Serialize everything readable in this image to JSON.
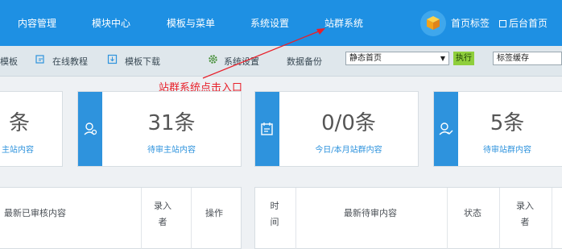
{
  "nav": {
    "items": [
      {
        "label": "内容管理"
      },
      {
        "label": "模块中心"
      },
      {
        "label": "模板与菜单"
      },
      {
        "label": "系统设置"
      },
      {
        "label": "站群系统"
      }
    ],
    "home_tag": "首页标签",
    "backstage": "后台首页"
  },
  "toolbar": {
    "template_partial": "模板",
    "online_tutorial": "在线教程",
    "template_download": "模板下载",
    "system_settings": "系统设置",
    "data_backup": "数据备份",
    "static_select": "静态首页",
    "execute": "执行",
    "tag_cache_select": "标签缓存"
  },
  "annotation": {
    "text": "站群系统点击入口",
    "color": "#e8202a"
  },
  "stats": [
    {
      "value": "条",
      "label": "主站内容",
      "icon": "content-icon"
    },
    {
      "value": "31条",
      "label": "待审主站内容",
      "icon": "review-user-icon"
    },
    {
      "value": "0/0条",
      "label": "今日/本月站群内容",
      "icon": "calendar-doc-icon"
    },
    {
      "value": "5条",
      "label": "待审站群内容",
      "icon": "user-check-icon"
    }
  ],
  "table_left": {
    "headers": [
      "最新已审核内容",
      "录入\n者",
      "操作"
    ]
  },
  "table_right": {
    "headers": [
      "时\n间",
      "最新待审内容",
      "状态",
      "录入\n者"
    ]
  },
  "colors": {
    "nav_bg": "#1e90e3",
    "accent": "#2e93dd",
    "execute_btn": "#8fcf3c"
  }
}
